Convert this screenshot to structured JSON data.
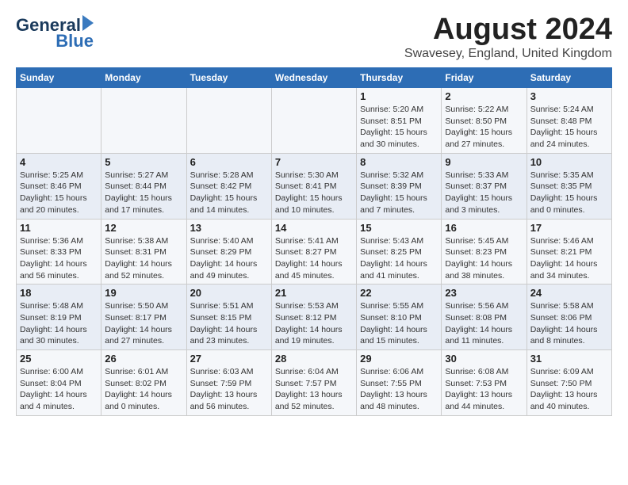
{
  "header": {
    "logo_line1": "General",
    "logo_line2": "Blue",
    "title": "August 2024",
    "subtitle": "Swavesey, England, United Kingdom"
  },
  "calendar": {
    "headers": [
      "Sunday",
      "Monday",
      "Tuesday",
      "Wednesday",
      "Thursday",
      "Friday",
      "Saturday"
    ],
    "weeks": [
      [
        {
          "day": "",
          "info": ""
        },
        {
          "day": "",
          "info": ""
        },
        {
          "day": "",
          "info": ""
        },
        {
          "day": "",
          "info": ""
        },
        {
          "day": "1",
          "info": "Sunrise: 5:20 AM\nSunset: 8:51 PM\nDaylight: 15 hours\nand 30 minutes."
        },
        {
          "day": "2",
          "info": "Sunrise: 5:22 AM\nSunset: 8:50 PM\nDaylight: 15 hours\nand 27 minutes."
        },
        {
          "day": "3",
          "info": "Sunrise: 5:24 AM\nSunset: 8:48 PM\nDaylight: 15 hours\nand 24 minutes."
        }
      ],
      [
        {
          "day": "4",
          "info": "Sunrise: 5:25 AM\nSunset: 8:46 PM\nDaylight: 15 hours\nand 20 minutes."
        },
        {
          "day": "5",
          "info": "Sunrise: 5:27 AM\nSunset: 8:44 PM\nDaylight: 15 hours\nand 17 minutes."
        },
        {
          "day": "6",
          "info": "Sunrise: 5:28 AM\nSunset: 8:42 PM\nDaylight: 15 hours\nand 14 minutes."
        },
        {
          "day": "7",
          "info": "Sunrise: 5:30 AM\nSunset: 8:41 PM\nDaylight: 15 hours\nand 10 minutes."
        },
        {
          "day": "8",
          "info": "Sunrise: 5:32 AM\nSunset: 8:39 PM\nDaylight: 15 hours\nand 7 minutes."
        },
        {
          "day": "9",
          "info": "Sunrise: 5:33 AM\nSunset: 8:37 PM\nDaylight: 15 hours\nand 3 minutes."
        },
        {
          "day": "10",
          "info": "Sunrise: 5:35 AM\nSunset: 8:35 PM\nDaylight: 15 hours\nand 0 minutes."
        }
      ],
      [
        {
          "day": "11",
          "info": "Sunrise: 5:36 AM\nSunset: 8:33 PM\nDaylight: 14 hours\nand 56 minutes."
        },
        {
          "day": "12",
          "info": "Sunrise: 5:38 AM\nSunset: 8:31 PM\nDaylight: 14 hours\nand 52 minutes."
        },
        {
          "day": "13",
          "info": "Sunrise: 5:40 AM\nSunset: 8:29 PM\nDaylight: 14 hours\nand 49 minutes."
        },
        {
          "day": "14",
          "info": "Sunrise: 5:41 AM\nSunset: 8:27 PM\nDaylight: 14 hours\nand 45 minutes."
        },
        {
          "day": "15",
          "info": "Sunrise: 5:43 AM\nSunset: 8:25 PM\nDaylight: 14 hours\nand 41 minutes."
        },
        {
          "day": "16",
          "info": "Sunrise: 5:45 AM\nSunset: 8:23 PM\nDaylight: 14 hours\nand 38 minutes."
        },
        {
          "day": "17",
          "info": "Sunrise: 5:46 AM\nSunset: 8:21 PM\nDaylight: 14 hours\nand 34 minutes."
        }
      ],
      [
        {
          "day": "18",
          "info": "Sunrise: 5:48 AM\nSunset: 8:19 PM\nDaylight: 14 hours\nand 30 minutes."
        },
        {
          "day": "19",
          "info": "Sunrise: 5:50 AM\nSunset: 8:17 PM\nDaylight: 14 hours\nand 27 minutes."
        },
        {
          "day": "20",
          "info": "Sunrise: 5:51 AM\nSunset: 8:15 PM\nDaylight: 14 hours\nand 23 minutes."
        },
        {
          "day": "21",
          "info": "Sunrise: 5:53 AM\nSunset: 8:12 PM\nDaylight: 14 hours\nand 19 minutes."
        },
        {
          "day": "22",
          "info": "Sunrise: 5:55 AM\nSunset: 8:10 PM\nDaylight: 14 hours\nand 15 minutes."
        },
        {
          "day": "23",
          "info": "Sunrise: 5:56 AM\nSunset: 8:08 PM\nDaylight: 14 hours\nand 11 minutes."
        },
        {
          "day": "24",
          "info": "Sunrise: 5:58 AM\nSunset: 8:06 PM\nDaylight: 14 hours\nand 8 minutes."
        }
      ],
      [
        {
          "day": "25",
          "info": "Sunrise: 6:00 AM\nSunset: 8:04 PM\nDaylight: 14 hours\nand 4 minutes."
        },
        {
          "day": "26",
          "info": "Sunrise: 6:01 AM\nSunset: 8:02 PM\nDaylight: 14 hours\nand 0 minutes."
        },
        {
          "day": "27",
          "info": "Sunrise: 6:03 AM\nSunset: 7:59 PM\nDaylight: 13 hours\nand 56 minutes."
        },
        {
          "day": "28",
          "info": "Sunrise: 6:04 AM\nSunset: 7:57 PM\nDaylight: 13 hours\nand 52 minutes."
        },
        {
          "day": "29",
          "info": "Sunrise: 6:06 AM\nSunset: 7:55 PM\nDaylight: 13 hours\nand 48 minutes."
        },
        {
          "day": "30",
          "info": "Sunrise: 6:08 AM\nSunset: 7:53 PM\nDaylight: 13 hours\nand 44 minutes."
        },
        {
          "day": "31",
          "info": "Sunrise: 6:09 AM\nSunset: 7:50 PM\nDaylight: 13 hours\nand 40 minutes."
        }
      ]
    ]
  }
}
